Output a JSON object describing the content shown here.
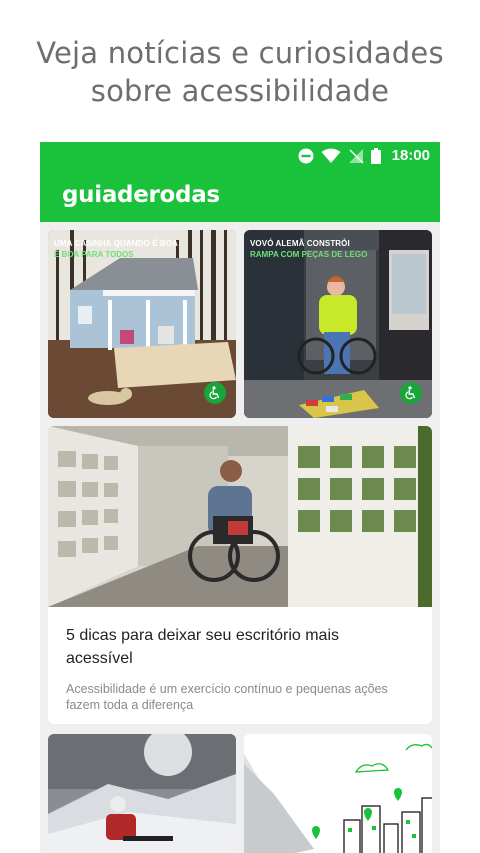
{
  "promo": {
    "line1": "Veja notícias e curiosidades",
    "line2": "sobre acessibilidade"
  },
  "status_bar": {
    "time": "18:00",
    "icons": [
      "do-not-disturb-icon",
      "wifi-icon",
      "no-signal-icon",
      "battery-icon"
    ]
  },
  "app_bar": {
    "title": "guiaderodas"
  },
  "colors": {
    "brand_green": "#19c23a",
    "badge_green": "#1aa53a",
    "subtitle_green": "#6ee07a"
  },
  "cards": {
    "house": {
      "title": "UMA CASINHA QUANDO É BOA",
      "subtitle": "É BOA PARA TODOS",
      "badge_icon": "wheelchair-icon"
    },
    "lego": {
      "title": "VOVÓ ALEMÃ CONSTRÓI",
      "subtitle": "RAMPA COM PEÇAS DE LEGO",
      "badge_icon": "wheelchair-icon"
    },
    "office": {
      "title": "5 dicas para deixar seu escritório mais acessível",
      "description": "Acessibilidade é um exercício contínuo e pequenas ações fazem toda a diferença"
    }
  }
}
